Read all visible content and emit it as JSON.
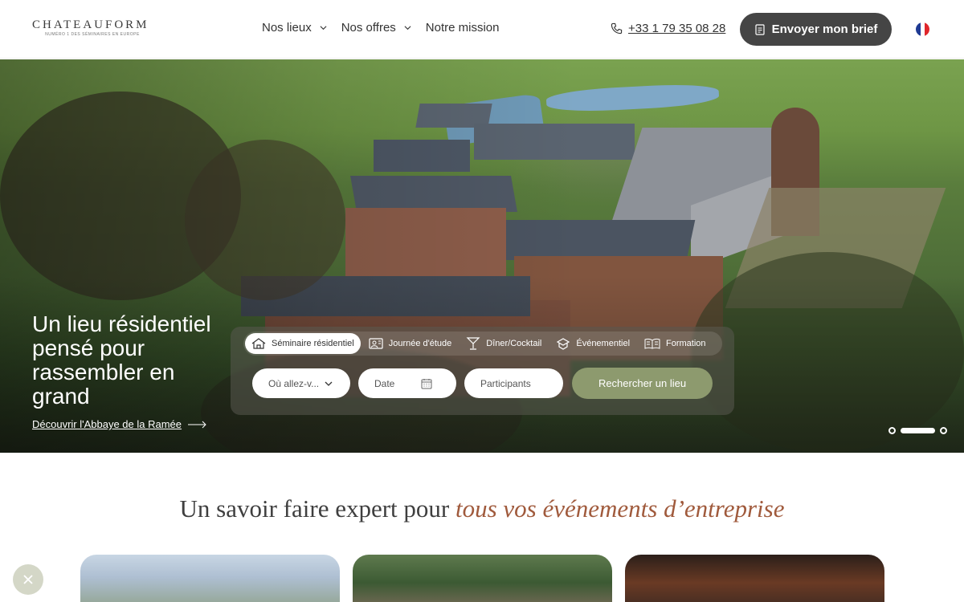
{
  "header": {
    "logo_main": "CHATEAUFORM",
    "logo_sub": "NUMÉRO 1 DES SÉMINAIRES EN EUROPE",
    "nav": [
      {
        "label": "Nos lieux"
      },
      {
        "label": "Nos offres"
      },
      {
        "label": "Notre mission"
      }
    ],
    "phone": "+33 1 79 35 08 28",
    "brief_button": "Envoyer mon brief",
    "flag_colors": [
      "#1f3a93",
      "#ffffff",
      "#e0262b"
    ]
  },
  "hero": {
    "title": "Un lieu résidentiel pensé pour rassembler en grand",
    "link": "Découvrir l'Abbaye de la Ramée"
  },
  "search": {
    "tabs": [
      {
        "label": "Séminaire résidentiel",
        "icon": "house-icon"
      },
      {
        "label": "Journée d'étude",
        "icon": "presentation-icon"
      },
      {
        "label": "Dîner/Cocktail",
        "icon": "cocktail-icon"
      },
      {
        "label": "Événementiel",
        "icon": "event-icon"
      },
      {
        "label": "Formation",
        "icon": "book-icon"
      }
    ],
    "destination_placeholder": "Où allez-v...",
    "date_placeholder": "Date",
    "participants_placeholder": "Participants",
    "button": "Rechercher un lieu"
  },
  "section": {
    "title_plain": "Un savoir faire expert pour ",
    "title_italic": "tous vos événements d’entreprise"
  },
  "colors": {
    "accent_brown": "#a05a3c",
    "search_button": "#8d9a6e",
    "brief_button": "#454545"
  }
}
